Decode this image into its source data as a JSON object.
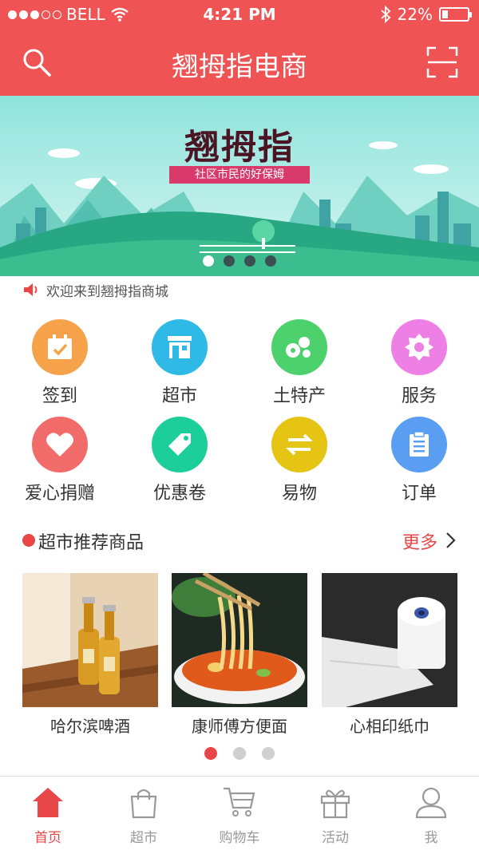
{
  "status_bar": {
    "carrier": "BELL",
    "time": "4:21 PM",
    "battery": "22%",
    "battery_level": 0.22
  },
  "header": {
    "title": "翘拇指电商"
  },
  "banner": {
    "title": "翘拇指",
    "subtitle": "社区市民的好保姆",
    "slides": 4,
    "active_slide": 0
  },
  "notice": {
    "text": "欢迎来到翘拇指商城"
  },
  "categories": [
    {
      "label": "签到",
      "icon": "calendar-check-icon",
      "color": "#f5a24a"
    },
    {
      "label": "超市",
      "icon": "store-icon",
      "color": "#2fb9e6"
    },
    {
      "label": "土特产",
      "icon": "produce-icon",
      "color": "#4cd16c"
    },
    {
      "label": "服务",
      "icon": "gear-icon",
      "color": "#ee7fe4"
    },
    {
      "label": "爱心捐赠",
      "icon": "heart-icon",
      "color": "#f26b6b"
    },
    {
      "label": "优惠卷",
      "icon": "tag-icon",
      "color": "#1ccf9a"
    },
    {
      "label": "易物",
      "icon": "exchange-icon",
      "color": "#e6c414"
    },
    {
      "label": "订单",
      "icon": "clipboard-icon",
      "color": "#5a9ef2"
    }
  ],
  "section": {
    "title": "超市推荐商品",
    "more": "更多"
  },
  "products": [
    {
      "name": "哈尔滨啤酒",
      "icon": "beer-image"
    },
    {
      "name": "康师傅方便面",
      "icon": "noodles-image"
    },
    {
      "name": "心相印纸巾",
      "icon": "tissue-image"
    }
  ],
  "product_pager": {
    "pages": 3,
    "active": 0
  },
  "tabs": [
    {
      "label": "首页",
      "icon": "home-icon",
      "active": true
    },
    {
      "label": "超市",
      "icon": "shopping-bag-icon",
      "active": false
    },
    {
      "label": "购物车",
      "icon": "cart-icon",
      "active": false
    },
    {
      "label": "活动",
      "icon": "gift-icon",
      "active": false
    },
    {
      "label": "我",
      "icon": "user-icon",
      "active": false
    }
  ],
  "colors": {
    "brand": "#ef5353",
    "accent": "#e94747",
    "inactive": "#999999"
  }
}
